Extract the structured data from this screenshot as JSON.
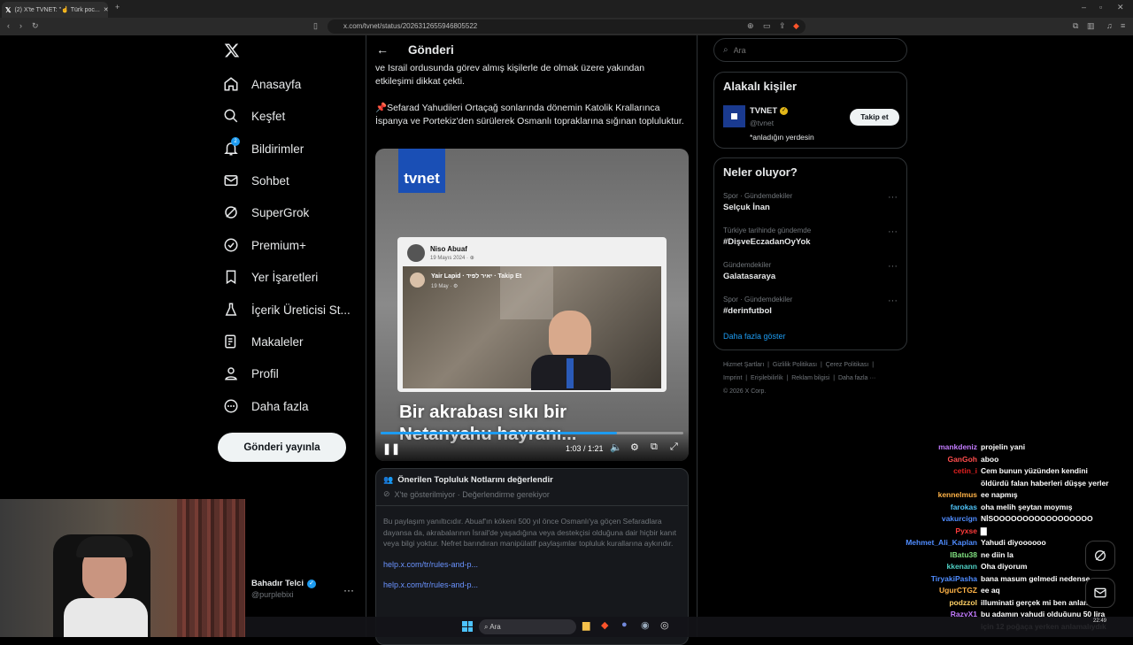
{
  "browser": {
    "tab_title": "(2) X'te TVNET: \"☝️ Türk poc...",
    "url": "x.com/tvnet/status/2026312655946805522"
  },
  "nav": {
    "items": [
      {
        "label": "Anasayfa"
      },
      {
        "label": "Keşfet"
      },
      {
        "label": "Bildirimler",
        "badge": "2"
      },
      {
        "label": "Sohbet"
      },
      {
        "label": "SuperGrok"
      },
      {
        "label": "Premium+"
      },
      {
        "label": "Yer İşaretleri"
      },
      {
        "label": "İçerik Üreticisi St..."
      },
      {
        "label": "Makaleler"
      },
      {
        "label": "Profil"
      },
      {
        "label": "Daha fazla"
      }
    ],
    "post_button": "Gönderi yayınla",
    "account": {
      "name": "Bahadır Telci",
      "handle": "@purplebixi"
    }
  },
  "main": {
    "header_title": "Gönderi",
    "text_line1": "ve Israil ordusunda görev almış kişilerle de olmak üzere yakından",
    "text_line2": "etkileşimi dikkat çekti.",
    "text_para2": "Sefarad Yahudileri Ortaçağ sonlarında dönemin Katolik Krallarınca İspanya ve Portekiz'den sürülerek Osmanlı topraklarına sığınan topluluktur.",
    "video": {
      "logo": "tvnet",
      "fb_name": "Niso Abuaf",
      "fb_date": "19 Mayıs 2024 · ",
      "inner_name": "Yair Lapid · יאיר לפיד · Takip Et",
      "inner_date": "19 May · ",
      "caption_line1": "Bir akrabası sıkı bir",
      "caption_line2": "Netanyahu hayranı...",
      "time": "1:03 / 1:21",
      "progress": 0.78
    },
    "community_note": {
      "title": "Önerilen Topluluk Notlarını değerlendir",
      "subtitle": "X'te gösterilmiyor · Değerlendirme gerekiyor",
      "body": "Bu paylaşım yanıltıcıdır. Abuaf'ın kökeni 500 yıl önce Osmanlı'ya göçen Sefaradlara dayansa da, akrabalarının İsrail'de yaşadığına veya destekçisi olduğuna dair hiçbir kanıt veya bilgi yoktur. Nefret barındıran manipülatif paylaşımlar topluluk kurallarına aykırıdır.",
      "link1": "help.x.com/tr/rules-and-p...",
      "link2": "help.x.com/tr/rules-and-p..."
    }
  },
  "right": {
    "search_placeholder": "Ara",
    "related_title": "Alakalı kişiler",
    "related_person": {
      "name": "TVNET",
      "handle": "@tvnet",
      "bio": "*anladığın yerdesin",
      "follow": "Takip et"
    },
    "trends_title": "Neler oluyor?",
    "trends": [
      {
        "category": "Spor · Gündemdekiler",
        "title": "Selçuk İnan"
      },
      {
        "category": "Türkiye tarihinde gündemde",
        "title": "#DişveEczadanOyYok"
      },
      {
        "category": "Gündemdekiler",
        "title": "Galatasaraya"
      },
      {
        "category": "Spor · Gündemdekiler",
        "title": "#derinfutbol"
      }
    ],
    "show_more": "Daha fazla göster",
    "footer_row1": [
      "Hizmet Şartları",
      "Gizlilik Politikası",
      "Çerez Politikası"
    ],
    "footer_row2": [
      "Imprint",
      "Erişilebilirlik",
      "Reklam bilgisi",
      "Daha fazla ···"
    ],
    "copyright": "© 2026 X Corp."
  },
  "chat": [
    {
      "name": "mankdeniz",
      "msg": "projelin yani",
      "color": "#c37cff"
    },
    {
      "name": "GanGoh",
      "msg": "aboo",
      "color": "#ff4d4d"
    },
    {
      "name": "cetin_i",
      "msg": "Cem bunun yüzünden kendini",
      "color": "#e02020"
    },
    {
      "name": "",
      "msg": "öldürdü falan haberleri düşşe yerler",
      "color": "#ffffff"
    },
    {
      "name": "kennelmus",
      "msg": "ee napmış",
      "color": "#ffb347"
    },
    {
      "name": "farokas",
      "msg": "oha melih şeytan moymış",
      "color": "#4fc3f7"
    },
    {
      "name": "vakurcign",
      "msg": "NİSOOOOOOOOOOOOOOOOO",
      "color": "#4f8cff"
    },
    {
      "name": "Pyxse",
      "msg": "▇",
      "color": "#ff3b3b"
    },
    {
      "name": "Mehmet_Ali_Kaplan",
      "msg": "Yahudi diyoooooo",
      "color": "#4f8cff"
    },
    {
      "name": "IBatu38",
      "msg": "ne diin la",
      "color": "#7fe07f"
    },
    {
      "name": "kkenann",
      "msg": "Oha diyorum",
      "color": "#4fd1c5"
    },
    {
      "name": "TiryakiPasha",
      "msg": "bana masum gelmedi nedense",
      "color": "#4f8cff"
    },
    {
      "name": "UgurCTGZ",
      "msg": "ee aq",
      "color": "#ffb347"
    },
    {
      "name": "podzzol",
      "msg": "illuminati gerçek mi ben anlamadım",
      "color": "#ffd166"
    },
    {
      "name": "RazyX1",
      "msg": "bu adamın yahudi olduğunu 50 lira",
      "color": "#c37cff"
    },
    {
      "name": "",
      "msg": "için 12 poğaça yerken anlamalıydık",
      "color": "#ffffff"
    }
  ],
  "taskbar": {
    "search": "Ara",
    "time": "22:49"
  }
}
